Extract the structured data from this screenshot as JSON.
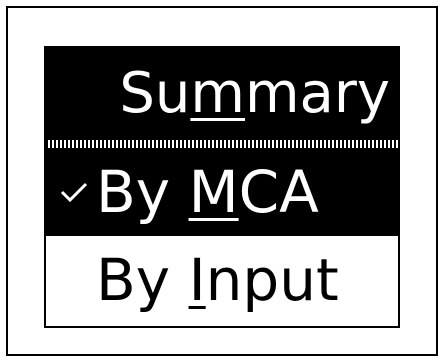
{
  "menu": {
    "title": {
      "before": "Su",
      "mnemonic": "m",
      "after": "mary"
    },
    "items": [
      {
        "checked": true,
        "before": "By ",
        "mnemonic": "M",
        "after": "CA",
        "selected": true
      },
      {
        "checked": false,
        "before": "By ",
        "mnemonic": "I",
        "after": "nput",
        "selected": false
      }
    ],
    "check_icon": "checkmark-icon"
  },
  "colors": {
    "background": "#ffffff",
    "highlight": "#000000",
    "highlight_text": "#ffffff",
    "text": "#000000"
  }
}
